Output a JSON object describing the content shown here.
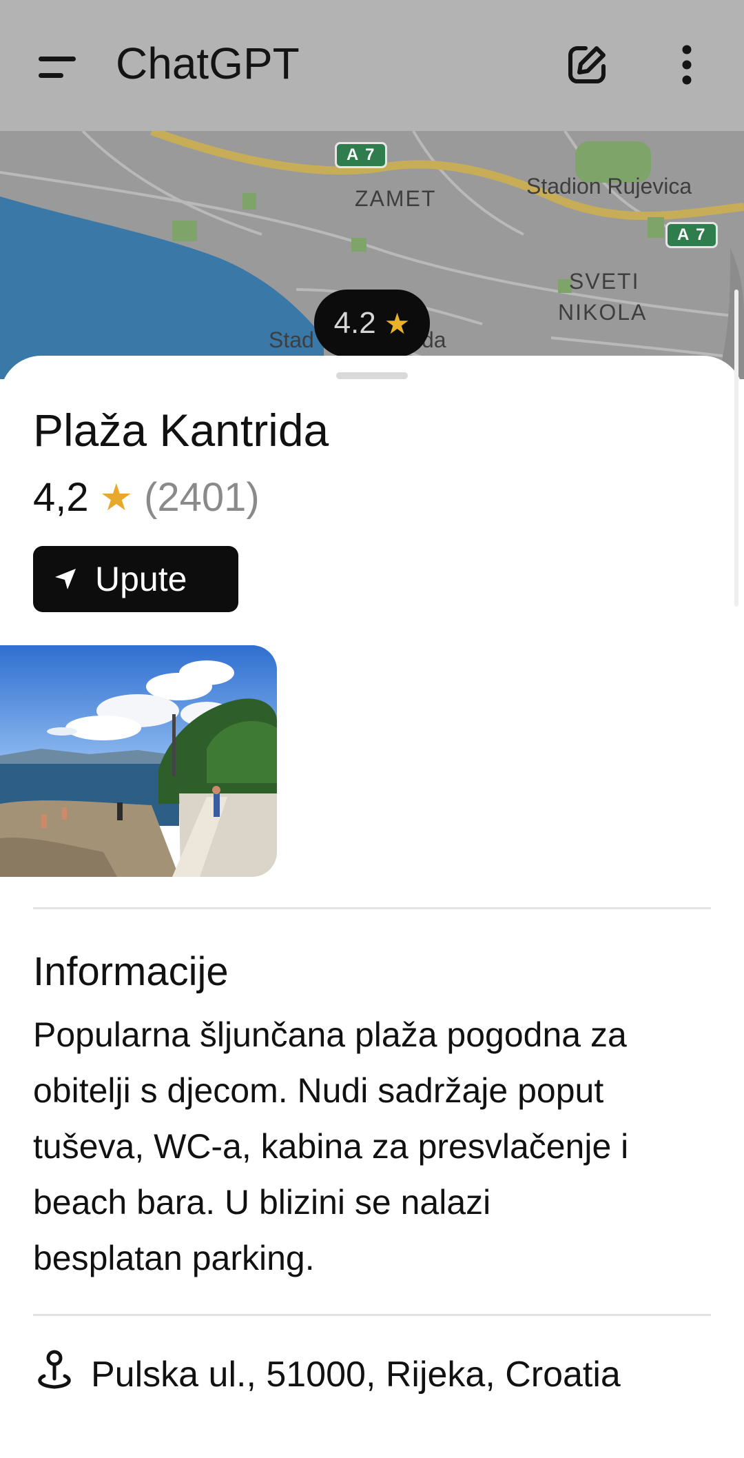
{
  "header": {
    "title": "ChatGPT",
    "menu_icon": "menu-icon",
    "compose_icon": "compose-icon",
    "more_icon": "more-vertical-icon"
  },
  "map": {
    "labels": {
      "zamet": "ZAMET",
      "stadion": "Stadion Rujevica",
      "sveti": "SVETI",
      "nikola": "NIKOLA",
      "stad_left": "Stad",
      "stad_right": "da"
    },
    "road_shield": "A 7",
    "pin_rating": "4.2",
    "pin_star": "★"
  },
  "place": {
    "name": "Plaža Kantrida",
    "rating": "4,2",
    "star": "★",
    "review_count": "(2401)",
    "directions_label": "Upute",
    "directions_icon": "navigation-arrow-icon",
    "photo_icon": "beach-photo"
  },
  "info": {
    "title": "Informacije",
    "lines": [
      "Popularna šljunčana plaža pogodna za",
      "obitelji s djecom. Nudi sadržaje poput",
      "tuševa, WC-a, kabina za presvlačenje i",
      "beach bara. U blizini se nalazi",
      "besplatan parking."
    ]
  },
  "address": {
    "icon": "location-pin-icon",
    "text": "Pulska ul., 51000, Rijeka, Croatia"
  },
  "colors": {
    "header_bg": "#b3b3b3",
    "accent_star": "#e8a92a",
    "button_bg": "#0d0d0d"
  }
}
